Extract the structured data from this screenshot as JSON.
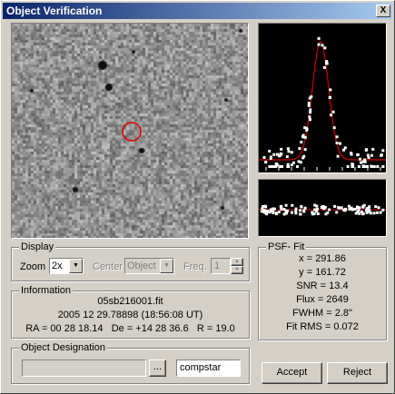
{
  "window": {
    "title": "Object Verification",
    "close_glyph": "X"
  },
  "image_view": {
    "marker_color": "#e00000"
  },
  "psf_plot": {
    "curve_color": "#d00000",
    "point_color": "#ffffff"
  },
  "display": {
    "group_label": "Display",
    "zoom_label": "Zoom",
    "zoom_value": "2x",
    "center_label": "Center",
    "center_value": "Object",
    "freq_label": "Freq.",
    "freq_value": "1"
  },
  "information": {
    "group_label": "Information",
    "filename": "05sb216001.fit",
    "datetime": "2005 12 29.78898 (18:56:08 UT)",
    "coords": "RA = 00 28 18.14   De = +14 28 36.6   R = 19.0"
  },
  "designation": {
    "group_label": "Object Designation",
    "field_value": "",
    "browse_label": "...",
    "tag_value": "compstar"
  },
  "psf_fit": {
    "group_label": "PSF- Fit",
    "lines": [
      "x = 291.86",
      "y = 161.72",
      "SNR = 13.4",
      "Flux = 2649",
      "FWHM = 2.8\"",
      "Fit RMS = 0.072"
    ]
  },
  "buttons": {
    "accept": "Accept",
    "reject": "Reject"
  }
}
